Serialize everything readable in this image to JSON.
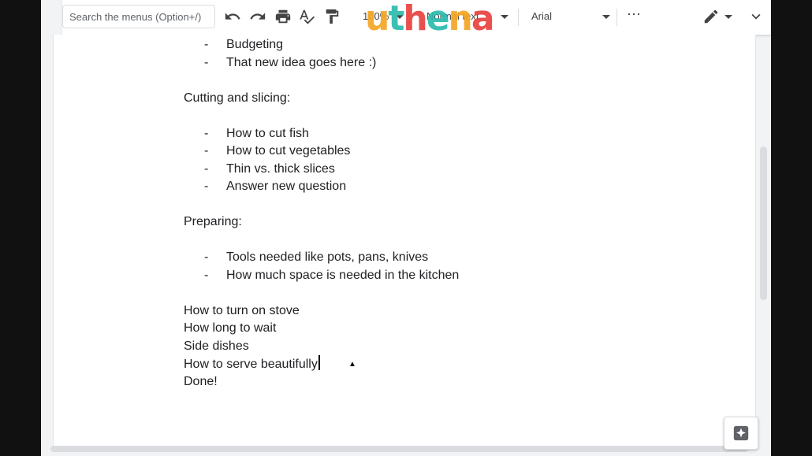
{
  "toolbar": {
    "search_placeholder": "Search the menus (Option+/)",
    "zoom": "100%",
    "style": "Normal text",
    "font": "Arial",
    "more": "⋯"
  },
  "watermark": {
    "letters": [
      "u",
      "t",
      "h",
      "e",
      "n",
      "a"
    ],
    "colors": [
      "#f5a623",
      "#2bbbad",
      "#e8423f",
      "#2bbbad",
      "#f5a623",
      "#e8423f"
    ]
  },
  "document": {
    "top_bullets": [
      "Budgeting",
      "That new idea goes here :)"
    ],
    "section1_heading": "Cutting and slicing:",
    "section1_bullets": [
      "How to cut fish",
      "How to cut vegetables",
      "Thin vs. thick slices",
      "Answer new question"
    ],
    "section2_heading": "Preparing:",
    "section2_bullets": [
      "Tools needed like pots, pans, knives",
      "How much space is needed in the kitchen"
    ],
    "lines": [
      "How to turn on stove",
      "How long to wait",
      "Side dishes",
      "How to serve beautifully",
      "Done!"
    ],
    "dash": "-"
  }
}
